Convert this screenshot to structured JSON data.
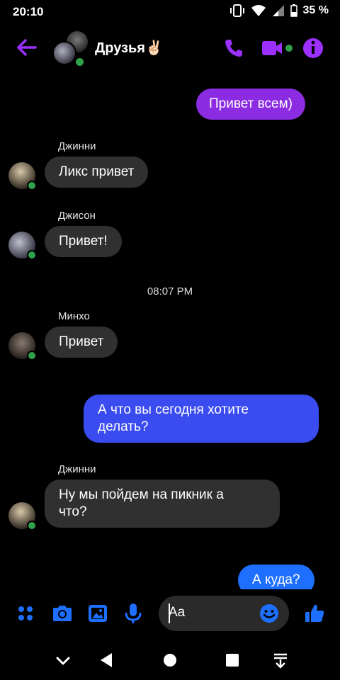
{
  "status": {
    "time": "20:10",
    "battery": "35 %"
  },
  "header": {
    "title": "Друзья✌🏻"
  },
  "messages": {
    "m1": "Привет всем)",
    "s1": "Джинни",
    "m2": "Ликс привет",
    "s2": "Джисон",
    "m3": "Привет!",
    "stamp": "08:07 PM",
    "s3": "Минхо",
    "m4": "Привет",
    "m5_l1": "А что вы сегодня хотите",
    "m5_l2": "делать?",
    "s4": "Джинни",
    "m6_l1": "Ну мы пойдем на пикник а",
    "m6_l2": "что?",
    "m7": "А куда?"
  },
  "composer": {
    "placeholder": "Aa"
  },
  "colors": {
    "accent": "#9b30ff",
    "blue": "#1e6fff",
    "online": "#31a24c"
  }
}
